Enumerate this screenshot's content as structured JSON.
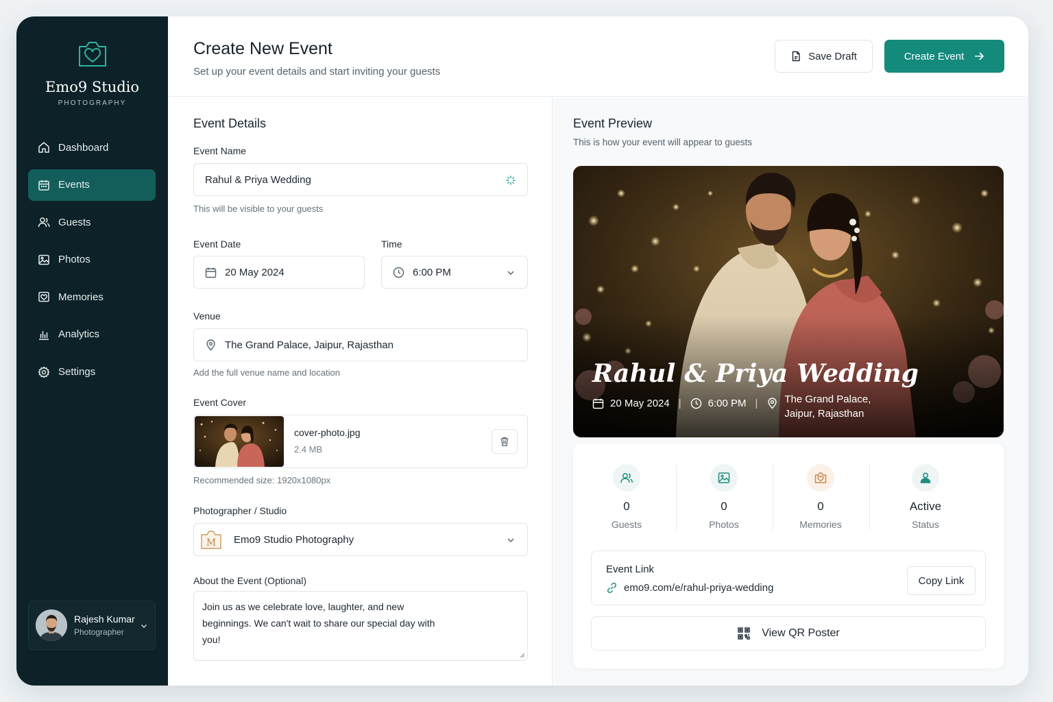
{
  "brand": {
    "name": "Emo9 Studio",
    "tagline": "PHOTOGRAPHY"
  },
  "nav": {
    "items": [
      {
        "label": "Dashboard",
        "icon": "home-icon"
      },
      {
        "label": "Events",
        "icon": "calendar-icon",
        "active": true
      },
      {
        "label": "Guests",
        "icon": "users-icon"
      },
      {
        "label": "Photos",
        "icon": "image-icon"
      },
      {
        "label": "Memories",
        "icon": "memories-icon"
      },
      {
        "label": "Analytics",
        "icon": "bar-chart-icon"
      },
      {
        "label": "Settings",
        "icon": "gear-icon"
      }
    ]
  },
  "user": {
    "name": "Rajesh Kumar",
    "role": "Photographer"
  },
  "header": {
    "title": "Create New Event",
    "subtitle": "Set up your event details and start inviting your guests",
    "save_draft": "Save Draft",
    "create_event": "Create Event"
  },
  "form": {
    "section_title": "Event Details",
    "event_name_label": "Event Name",
    "event_name_value": "Rahul & Priya Wedding",
    "event_name_hint": "This will be visible to your guests",
    "date_label": "Event Date",
    "date_value": "20 May 2024",
    "time_label": "Time",
    "time_value": "6:00 PM",
    "venue_label": "Venue",
    "venue_value": "The Grand Palace, Jaipur, Rajasthan",
    "venue_hint": "Add the full venue name and location",
    "cover_label": "Event Cover",
    "cover_file": "cover-photo.jpg",
    "cover_size": "2.4 MB",
    "cover_hint": "Recommended size: 1920x1080px",
    "photographer_label": "Photographer / Studio",
    "photographer_value": "Emo9 Studio Photography",
    "about_label": "About the Event (Optional)",
    "about_value": "Join us as we celebrate love, laughter, and new beginnings. We can't wait to share our special day with you!"
  },
  "preview": {
    "title": "Event Preview",
    "subtitle": "This is how your event will appear to guests",
    "hero_title": "Rahul & Priya Wedding",
    "hero_date": "20 May 2024",
    "hero_time": "6:00 PM",
    "hero_venue_line1": "The Grand Palace,",
    "hero_venue_line2": "Jaipur, Rajasthan",
    "stats": [
      {
        "value": "0",
        "label": "Guests",
        "icon": "users-icon"
      },
      {
        "value": "0",
        "label": "Photos",
        "icon": "image-icon"
      },
      {
        "value": "0",
        "label": "Memories",
        "icon": "memories-icon"
      },
      {
        "value": "Active",
        "label": "Status",
        "icon": "user-icon"
      }
    ],
    "link_title": "Event Link",
    "link_url": "emo9.com/e/rahul-priya-wedding",
    "copy_link": "Copy Link",
    "qr_button": "View QR Poster"
  },
  "colors": {
    "sidebar": "#0d2228",
    "accent": "#138a7c",
    "active_nav": "#135e5b"
  }
}
